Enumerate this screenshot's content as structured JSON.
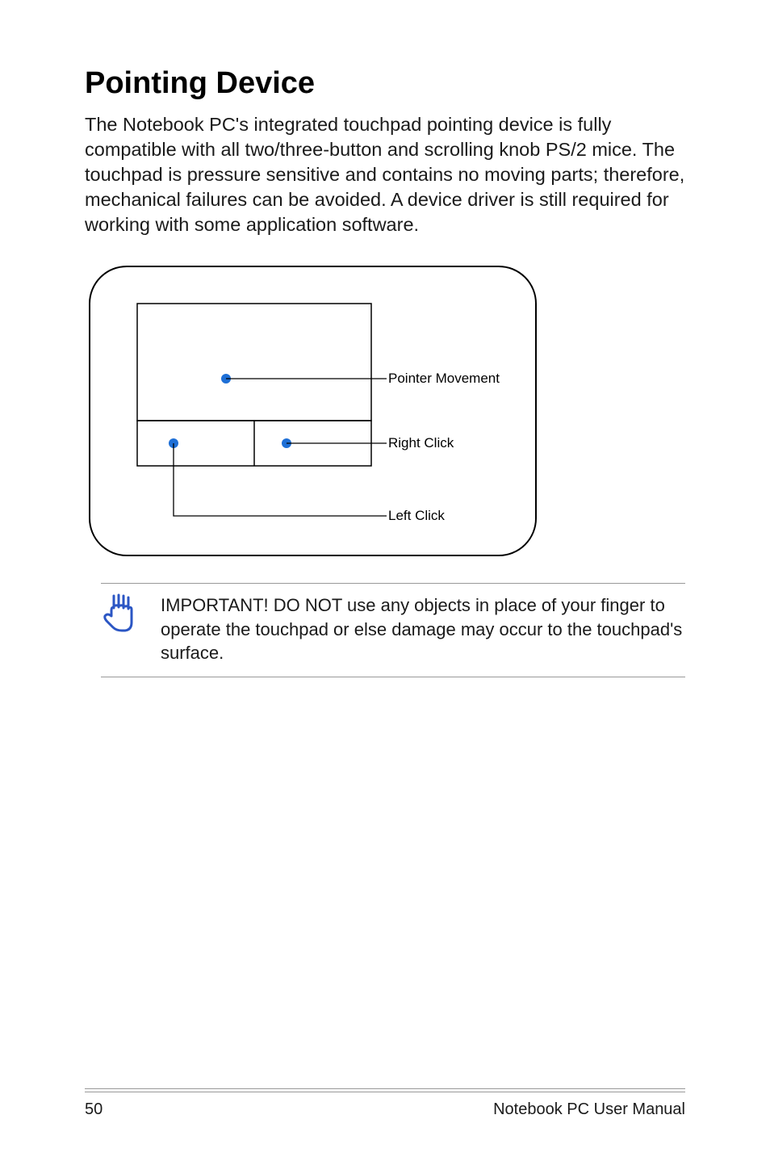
{
  "heading": "Pointing Device",
  "body": "The Notebook PC's integrated touchpad pointing device is fully compatible with all two/three-button and scrolling knob PS/2 mice. The touchpad is pressure sensitive and contains no moving parts; therefore, mechanical failures can be avoided. A device driver is still required for working with some application software.",
  "diagram": {
    "label_pointer": "Pointer Movement",
    "label_right": "Right Click",
    "label_left": "Left Click"
  },
  "callout": "IMPORTANT! DO NOT use any objects in place of your finger to operate the touchpad or else damage may occur to the touchpad's surface.",
  "footer": {
    "page": "50",
    "title": "Notebook PC User Manual"
  }
}
